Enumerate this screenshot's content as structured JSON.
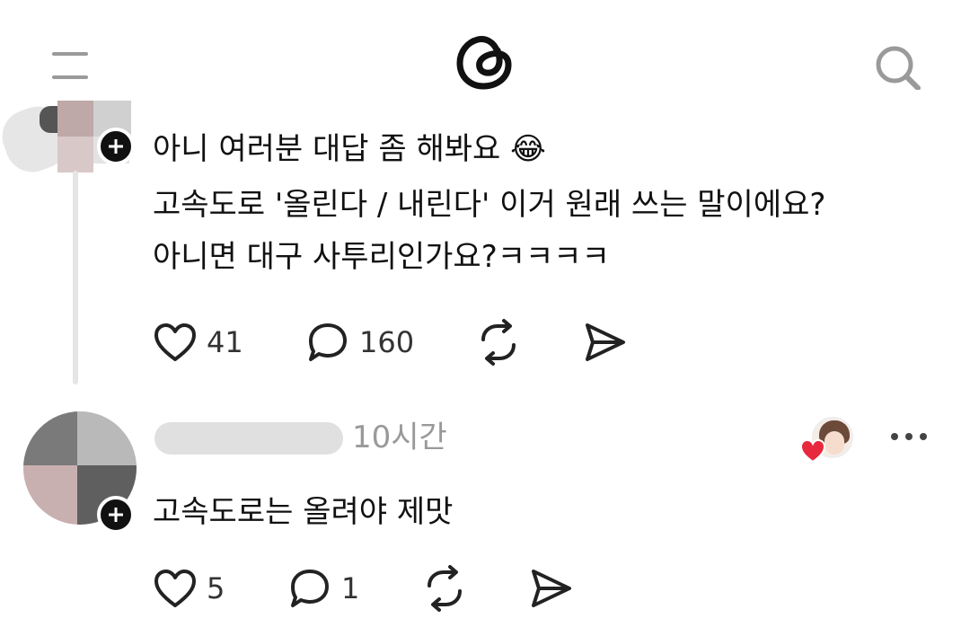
{
  "post": {
    "lines": [
      "아니 여러분 대답 좀 해봐요 😂",
      "고속도로 '올린다 / 내린다' 이거 원래 쓰는 말이에요?",
      "아니면 대구 사투리인가요?ㅋㅋㅋㅋ"
    ],
    "likes": "41",
    "comments": "160"
  },
  "reply": {
    "time": "10시간",
    "text": "고속도로는 올려야 제맛",
    "likes": "5",
    "comments": "1"
  },
  "icons": {
    "menu": "menu-icon",
    "logo": "threads-logo-icon",
    "search": "search-icon",
    "like": "heart-icon",
    "comment": "comment-icon",
    "repost": "repost-icon",
    "share": "share-icon",
    "more": "more-icon"
  },
  "colors": {
    "text": "#111111",
    "icon": "#222222",
    "muted": "#999999",
    "heart_badge": "#e8283c"
  }
}
